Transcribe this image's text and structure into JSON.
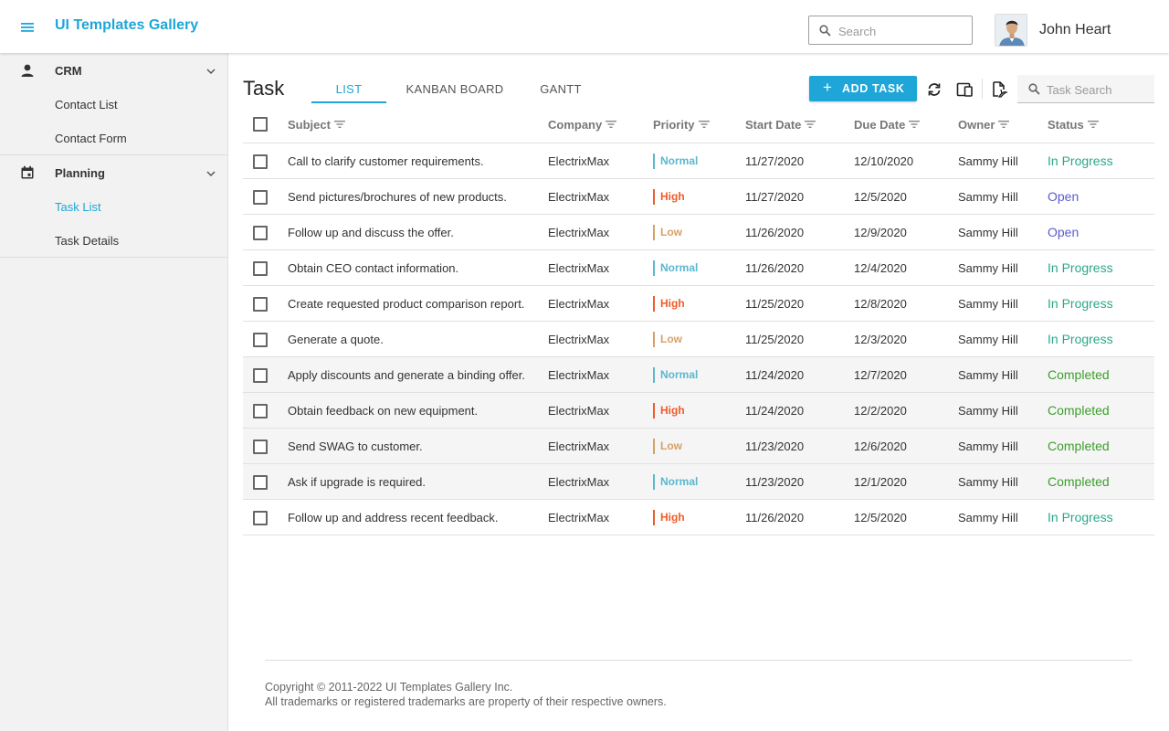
{
  "header": {
    "title": "UI Templates Gallery",
    "search_placeholder": "Search",
    "user_name": "John Heart"
  },
  "sidebar": {
    "groups": [
      {
        "label": "CRM",
        "icon": "person-icon",
        "items": [
          {
            "label": "Contact List"
          },
          {
            "label": "Contact Form"
          }
        ]
      },
      {
        "label": "Planning",
        "icon": "calendar-icon",
        "items": [
          {
            "label": "Task List",
            "active": true
          },
          {
            "label": "Task Details"
          }
        ]
      }
    ]
  },
  "main": {
    "title": "Task",
    "tabs": [
      {
        "label": "LIST",
        "active": true
      },
      {
        "label": "KANBAN BOARD"
      },
      {
        "label": "GANTT"
      }
    ],
    "add_button": "ADD TASK",
    "task_search_placeholder": "Task Search",
    "accent_color": "#1ea6d8"
  },
  "grid": {
    "columns": [
      "Subject",
      "Company",
      "Priority",
      "Start Date",
      "Due Date",
      "Owner",
      "Status"
    ],
    "rows": [
      {
        "subject": "Call to clarify customer requirements.",
        "company": "ElectrixMax",
        "priority": "Normal",
        "start": "11/27/2020",
        "due": "12/10/2020",
        "owner": "Sammy Hill",
        "status": "In Progress"
      },
      {
        "subject": "Send pictures/brochures of new products.",
        "company": "ElectrixMax",
        "priority": "High",
        "start": "11/27/2020",
        "due": "12/5/2020",
        "owner": "Sammy Hill",
        "status": "Open"
      },
      {
        "subject": "Follow up and discuss the offer.",
        "company": "ElectrixMax",
        "priority": "Low",
        "start": "11/26/2020",
        "due": "12/9/2020",
        "owner": "Sammy Hill",
        "status": "Open"
      },
      {
        "subject": "Obtain CEO contact information.",
        "company": "ElectrixMax",
        "priority": "Normal",
        "start": "11/26/2020",
        "due": "12/4/2020",
        "owner": "Sammy Hill",
        "status": "In Progress"
      },
      {
        "subject": "Create requested product comparison report.",
        "company": "ElectrixMax",
        "priority": "High",
        "start": "11/25/2020",
        "due": "12/8/2020",
        "owner": "Sammy Hill",
        "status": "In Progress"
      },
      {
        "subject": "Generate a quote.",
        "company": "ElectrixMax",
        "priority": "Low",
        "start": "11/25/2020",
        "due": "12/3/2020",
        "owner": "Sammy Hill",
        "status": "In Progress"
      },
      {
        "subject": "Apply discounts and generate a binding offer.",
        "company": "ElectrixMax",
        "priority": "Normal",
        "start": "11/24/2020",
        "due": "12/7/2020",
        "owner": "Sammy Hill",
        "status": "Completed"
      },
      {
        "subject": "Obtain feedback on new equipment.",
        "company": "ElectrixMax",
        "priority": "High",
        "start": "11/24/2020",
        "due": "12/2/2020",
        "owner": "Sammy Hill",
        "status": "Completed"
      },
      {
        "subject": "Send SWAG to customer.",
        "company": "ElectrixMax",
        "priority": "Low",
        "start": "11/23/2020",
        "due": "12/6/2020",
        "owner": "Sammy Hill",
        "status": "Completed"
      },
      {
        "subject": "Ask if upgrade is required.",
        "company": "ElectrixMax",
        "priority": "Normal",
        "start": "11/23/2020",
        "due": "12/1/2020",
        "owner": "Sammy Hill",
        "status": "Completed"
      },
      {
        "subject": "Follow up and address recent feedback.",
        "company": "ElectrixMax",
        "priority": "High",
        "start": "11/26/2020",
        "due": "12/5/2020",
        "owner": "Sammy Hill",
        "status": "In Progress"
      }
    ]
  },
  "footer": {
    "copyright": "Copyright © 2011-2022 UI Templates Gallery Inc.",
    "trademarks": "All trademarks or registered trademarks are property of their respective owners."
  }
}
